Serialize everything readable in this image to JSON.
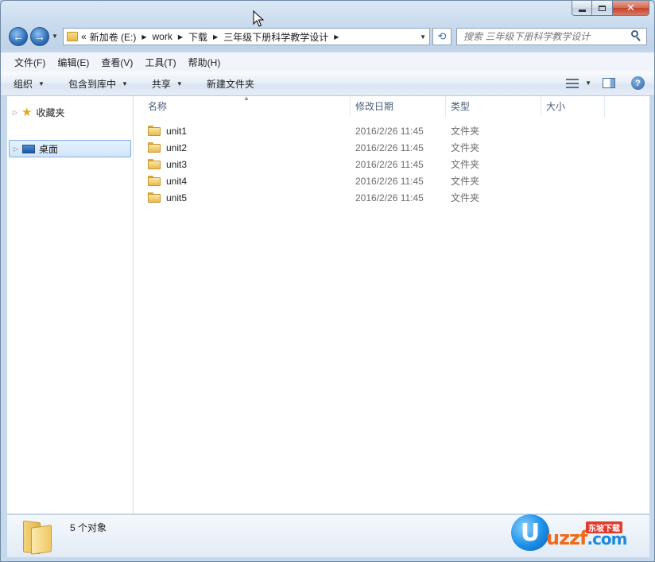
{
  "window": {
    "caption_close": "✕"
  },
  "navigation": {
    "back_glyph": "←",
    "forward_glyph": "→",
    "breadcrumb_overflow": "«",
    "breadcrumbs": [
      "新加卷 (E:)",
      "work",
      "下载",
      "三年级下册科学教学设计"
    ],
    "search_placeholder": "搜索 三年级下册科学教学设计"
  },
  "menu": [
    "文件(F)",
    "编辑(E)",
    "查看(V)",
    "工具(T)",
    "帮助(H)"
  ],
  "toolbar": {
    "organize": "组织",
    "include_in_library": "包含到库中",
    "share": "共享",
    "new_folder": "新建文件夹",
    "help_glyph": "?"
  },
  "nav_pane": {
    "favorites": "收藏夹",
    "desktop": "桌面"
  },
  "columns": {
    "name": "名称",
    "date_modified": "修改日期",
    "type": "类型",
    "size": "大小"
  },
  "files": [
    {
      "name": "unit1",
      "date": "2016/2/26 11:45",
      "type": "文件夹"
    },
    {
      "name": "unit2",
      "date": "2016/2/26 11:45",
      "type": "文件夹"
    },
    {
      "name": "unit3",
      "date": "2016/2/26 11:45",
      "type": "文件夹"
    },
    {
      "name": "unit4",
      "date": "2016/2/26 11:45",
      "type": "文件夹"
    },
    {
      "name": "unit5",
      "date": "2016/2/26 11:45",
      "type": "文件夹"
    }
  ],
  "details": {
    "item_count": "5 个对象"
  },
  "watermark": {
    "logo_letter": "U",
    "text_main": "uzzf",
    "text_suffix": ".com",
    "badge": "东坡下载"
  },
  "colors": {
    "accent": "#3b6fae",
    "selection": "#d1e6fb",
    "close_button": "#c5432b"
  }
}
